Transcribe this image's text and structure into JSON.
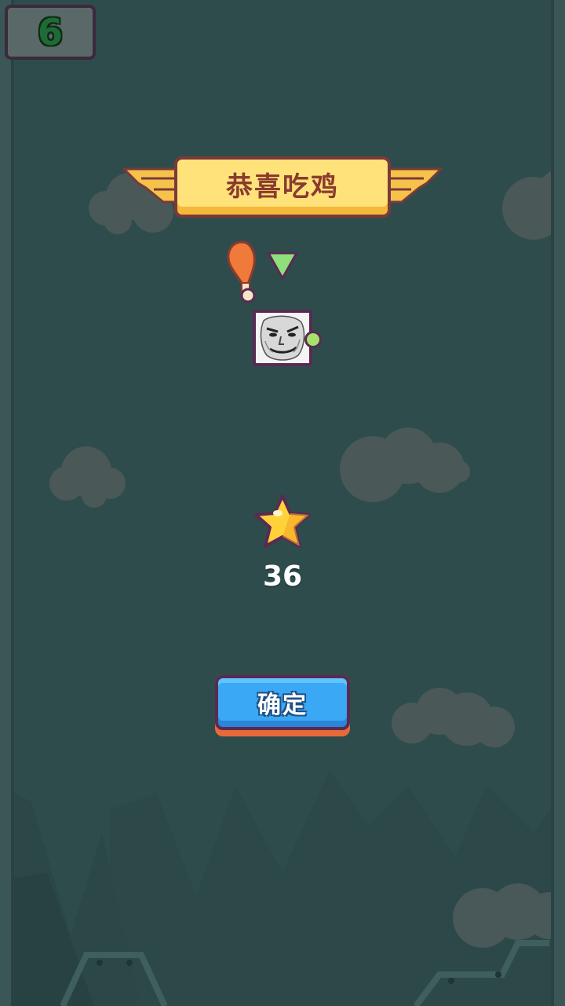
{
  "hud": {
    "level": "6"
  },
  "banner": {
    "title": "恭喜吃鸡"
  },
  "reward": {
    "stars": "36"
  },
  "actions": {
    "confirm_label": "确定"
  },
  "colors": {
    "background": "#2f4c4c",
    "banner": "#ffe27a",
    "button": "#3aa8f5",
    "star": "#ffd23a",
    "drumstick": "#f07a3a",
    "marker": "#8ee07a"
  },
  "icons": {
    "item": "drumstick-icon",
    "indicator": "triangle-down-icon",
    "reward": "star-icon"
  }
}
